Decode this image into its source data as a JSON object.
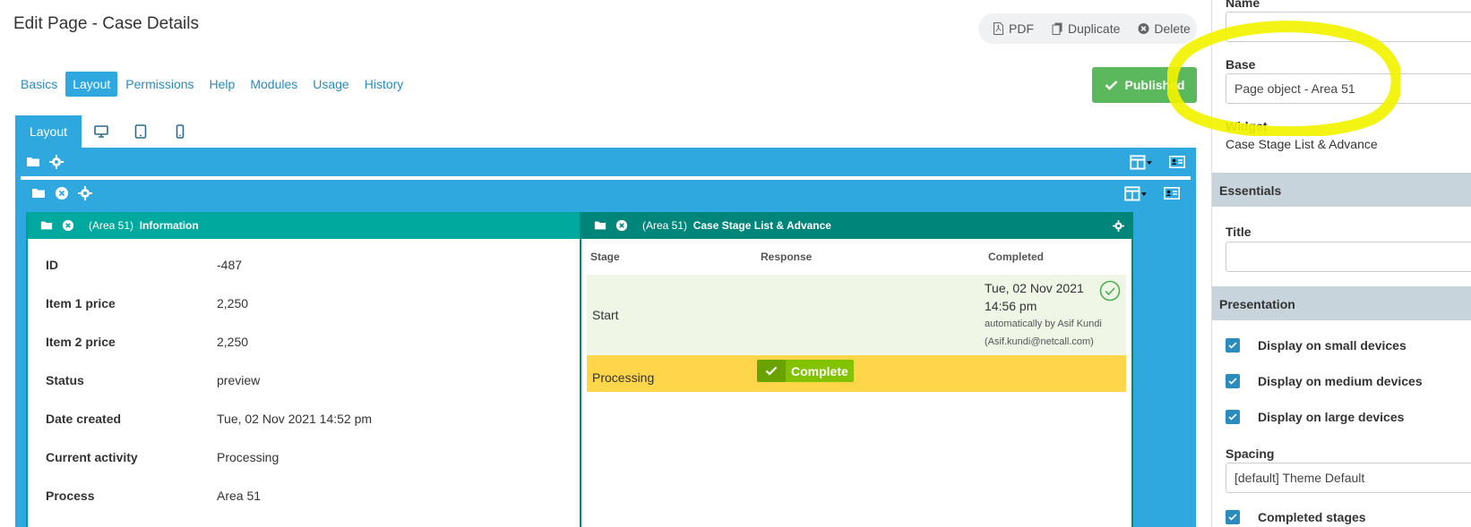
{
  "page": {
    "title": "Edit Page - Case Details"
  },
  "actions": {
    "pdf": "PDF",
    "duplicate": "Duplicate",
    "delete": "Delete"
  },
  "nav_tabs": [
    {
      "label": "Basics",
      "active": false
    },
    {
      "label": "Layout",
      "active": true
    },
    {
      "label": "Permissions",
      "active": false
    },
    {
      "label": "Help",
      "active": false
    },
    {
      "label": "Modules",
      "active": false
    },
    {
      "label": "Usage",
      "active": false
    },
    {
      "label": "History",
      "active": false
    }
  ],
  "publish": {
    "label": "Published"
  },
  "layout_tabs": {
    "layout_label": "Layout",
    "icons": [
      "desktop-icon",
      "tablet-icon",
      "mobile-icon"
    ]
  },
  "info_widget": {
    "area": "(Area 51)",
    "title": "Information",
    "rows": [
      {
        "label": "ID",
        "value": "-487"
      },
      {
        "label": "Item 1 price",
        "value": "2,250"
      },
      {
        "label": "Item 2 price",
        "value": "2,250"
      },
      {
        "label": "Status",
        "value": "preview"
      },
      {
        "label": "Date created",
        "value": "Tue, 02 Nov 2021 14:52 pm"
      },
      {
        "label": "Current activity",
        "value": "Processing"
      },
      {
        "label": "Process",
        "value": "Area 51"
      }
    ]
  },
  "stage_widget": {
    "area": "(Area 51)",
    "title": "Case Stage List & Advance",
    "headers": {
      "stage": "Stage",
      "response": "Response",
      "completed": "Completed"
    },
    "rows": [
      {
        "stage": "Start",
        "date": "Tue, 02 Nov 2021",
        "time": "14:56 pm",
        "by": "automatically by Asif Kundi",
        "email": "(Asif.kundi@netcall.com)",
        "done": true
      },
      {
        "stage": "Processing",
        "button": "Complete"
      }
    ]
  },
  "side": {
    "name_label": "Name",
    "name_value": "",
    "base_label": "Base",
    "base_value": "Page object - Area 51",
    "widget_label": "Widget",
    "widget_value": "Case Stage List & Advance",
    "essentials": "Essentials",
    "title_label": "Title",
    "title_value": "",
    "presentation": "Presentation",
    "checks": [
      {
        "label": "Display on small devices",
        "checked": true
      },
      {
        "label": "Display on medium devices",
        "checked": true
      },
      {
        "label": "Display on large devices",
        "checked": true
      }
    ],
    "spacing_label": "Spacing",
    "spacing_value": "[default] Theme Default",
    "completed_stages": "Completed stages"
  },
  "colors": {
    "accent_blue": "#2ea8de",
    "teal_header": "#00a99d",
    "dark_teal_header": "#00857a",
    "published_green": "#5cb85c",
    "completed_row": "#eff6e6",
    "processing_row": "#ffd54a",
    "complete_button": "#83c200",
    "highlight_yellow": "#f2f200"
  }
}
